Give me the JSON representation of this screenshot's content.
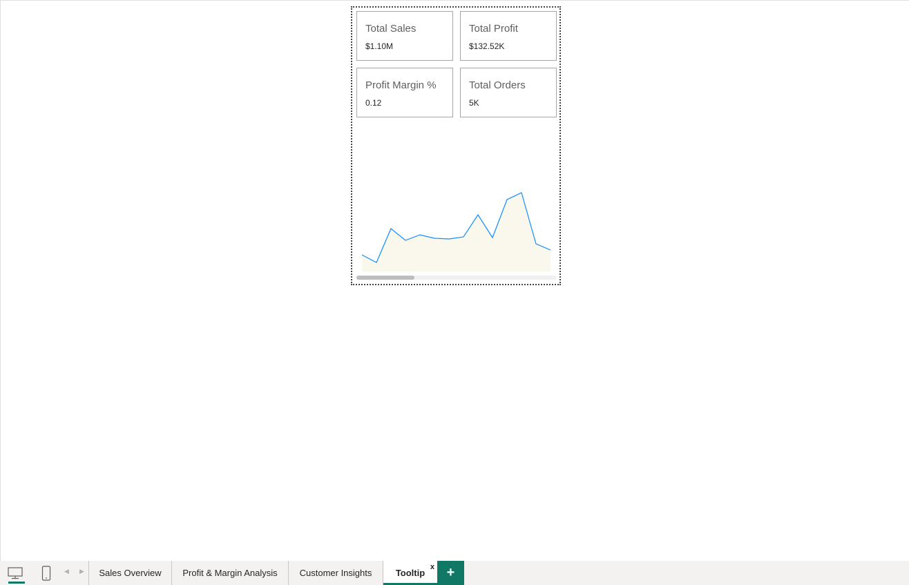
{
  "cards": [
    {
      "title": "Total Sales",
      "value": "$1.10M"
    },
    {
      "title": "Total Profit",
      "value": "$132.52K"
    },
    {
      "title": "Profit Margin %",
      "value": "0.12"
    },
    {
      "title": "Total Orders",
      "value": "5K"
    }
  ],
  "chart_data": {
    "type": "area",
    "series": [
      {
        "values": [
          24,
          13,
          62,
          45,
          53,
          48,
          47,
          50,
          82,
          49,
          104,
          114,
          40,
          31
        ]
      }
    ],
    "ylim": [
      0,
      150
    ],
    "line_color": "#118dff",
    "fill_color": "#faf7ec"
  },
  "tab_bar": {
    "view_buttons": [
      {
        "icon": "desktop-icon",
        "active": true
      },
      {
        "icon": "mobile-icon",
        "active": false
      }
    ],
    "tabs": [
      {
        "label": "Sales Overview",
        "active": false
      },
      {
        "label": "Profit & Margin Analysis",
        "active": false
      },
      {
        "label": "Customer Insights",
        "active": false
      },
      {
        "label": "Tooltip",
        "active": true
      }
    ],
    "close_glyph": "x",
    "add_glyph": "+"
  },
  "colors": {
    "accent": "#117865"
  }
}
